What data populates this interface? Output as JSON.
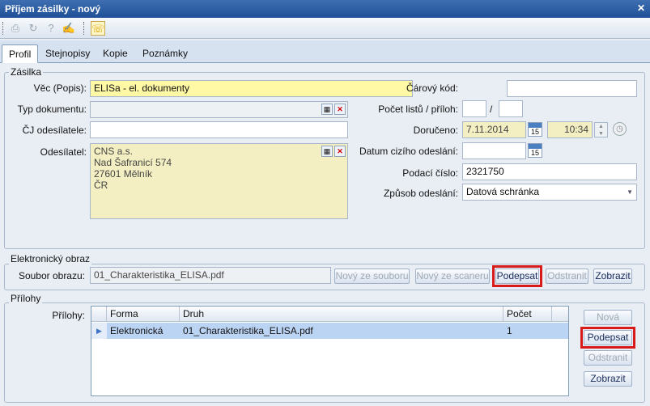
{
  "window": {
    "title": "Příjem zásilky - nový"
  },
  "tabs": [
    "Profil",
    "Stejnopisy",
    "Kopie",
    "Poznámky"
  ],
  "zasilka": {
    "legend": "Zásilka",
    "vec_label": "Věc (Popis):",
    "vec_value": "ELISa - el. dokumenty",
    "typ_label": "Typ dokumentu:",
    "typ_value": "",
    "cj_label": "ČJ odesílatele:",
    "cj_value": "",
    "odesilatel_label": "Odesílatel:",
    "odesilatel_lines": [
      "CNS a.s.",
      "Nad Šafranicí 574",
      "27601 Mělník",
      "ČR"
    ],
    "carovy_label": "Čárový kód:",
    "carovy_value": "",
    "pocet_label": "Počet listů / příloh:",
    "pocet_sep": "/",
    "doruceno_label": "Doručeno:",
    "doruceno_date": "7.11.2014",
    "doruceno_time": "10:34",
    "datum_ciziho_label": "Datum cizího odeslání:",
    "podaci_label": "Podací číslo:",
    "podaci_value": "2321750",
    "zpusob_label": "Způsob odeslání:",
    "zpusob_value": "Datová schránka",
    "calendar_day": "15"
  },
  "obraz": {
    "legend": "Elektronický obraz",
    "soubor_label": "Soubor obrazu:",
    "soubor_value": "01_Charakteristika_ELISA.pdf",
    "btn_novy_soubor": "Nový ze souboru",
    "btn_novy_scaneru": "Nový ze scaneru",
    "btn_podepsat": "Podepsat",
    "btn_odstranit": "Odstranit",
    "btn_zobrazit": "Zobrazit"
  },
  "prilohy": {
    "legend": "Přílohy",
    "label": "Přílohy:",
    "columns": [
      "Forma",
      "Druh",
      "Počet"
    ],
    "rows": [
      {
        "forma": "Elektronická",
        "druh": "01_Charakteristika_ELISA.pdf",
        "pocet": "1"
      }
    ],
    "btn_nova": "Nová",
    "btn_podepsat": "Podepsat",
    "btn_odstranit": "Odstranit",
    "btn_zobrazit": "Zobrazit"
  }
}
